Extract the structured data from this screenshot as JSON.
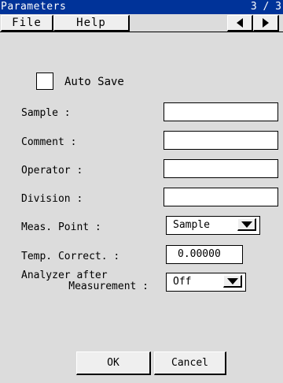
{
  "window": {
    "title": "Parameters",
    "page_indicator": "3 / 3"
  },
  "menu": {
    "file": "File",
    "help": "Help"
  },
  "nav": {
    "prev_icon": "left-triangle",
    "next_icon": "right-triangle"
  },
  "auto_save": {
    "label": "Auto Save",
    "checked": false
  },
  "fields": {
    "sample": {
      "label": "Sample :",
      "value": ""
    },
    "comment": {
      "label": "Comment :",
      "value": ""
    },
    "operator": {
      "label": "Operator :",
      "value": ""
    },
    "division": {
      "label": "Division :",
      "value": ""
    }
  },
  "meas_point": {
    "label": "Meas. Point :",
    "value": "Sample"
  },
  "temp_correct": {
    "label": "Temp. Correct. :",
    "value": "0.00000"
  },
  "analyzer": {
    "label_line1": "Analyzer after",
    "label_line2": "Measurement :",
    "value": "Off"
  },
  "buttons": {
    "ok": "OK",
    "cancel": "Cancel"
  },
  "colors": {
    "titlebar": "#003399",
    "background": "#dcdcdc"
  }
}
